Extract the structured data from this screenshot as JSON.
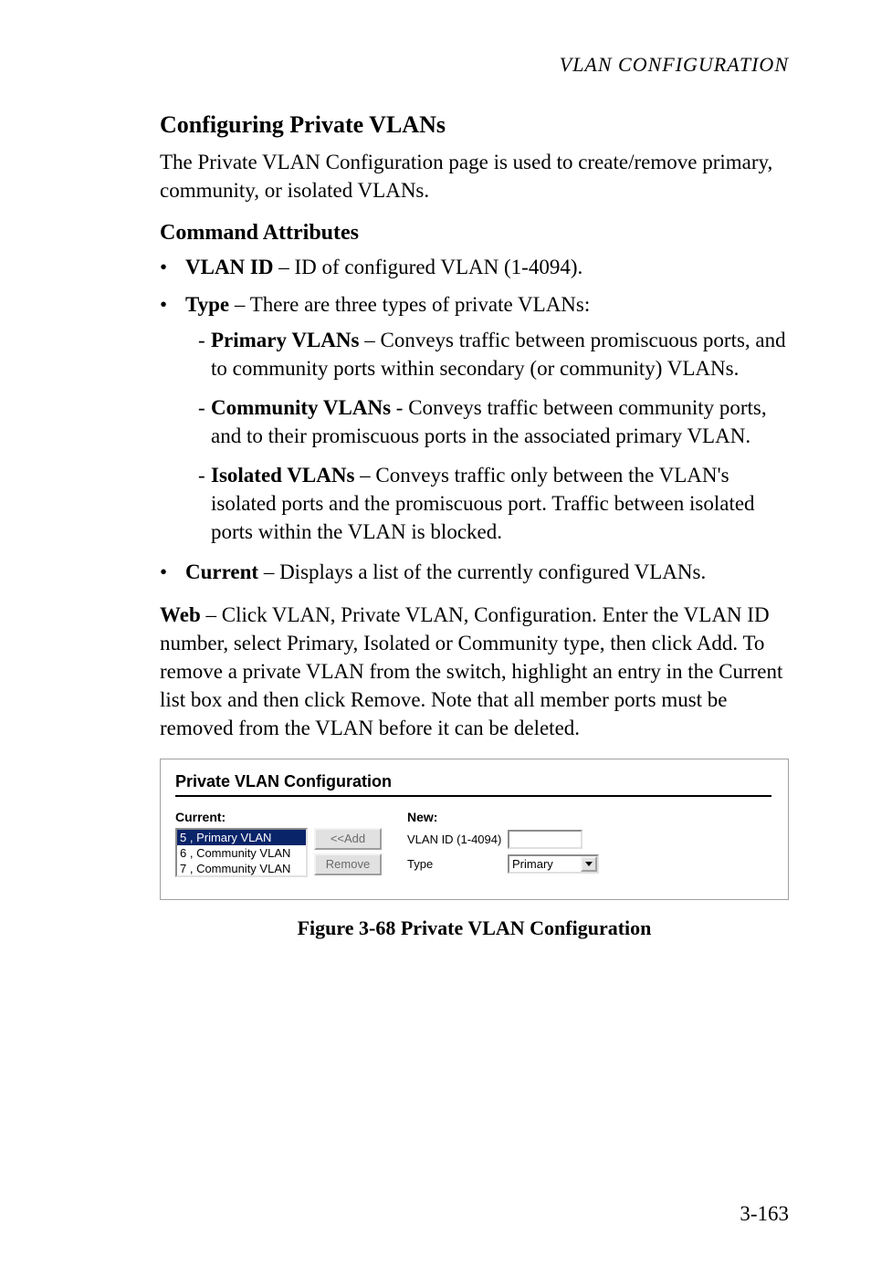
{
  "header": {
    "running_title": "VLAN CONFIGURATION"
  },
  "section": {
    "h2": "Configuring Private VLANs",
    "intro": "The Private VLAN Configuration page is used to create/remove primary, community, or isolated VLANs.",
    "h3": "Command Attributes",
    "bullets": {
      "vlan_id_bold": "VLAN ID",
      "vlan_id_rest": " – ID of configured VLAN (1-4094).",
      "type_bold": "Type",
      "type_rest": " – There are three types of private VLANs:",
      "sub": {
        "primary_bold": "Primary VLANs",
        "primary_rest": " – Conveys traffic between promiscuous ports, and to community ports within secondary (or community) VLANs.",
        "community_bold": "Community VLANs",
        "community_rest": " - Conveys traffic between community ports, and to their  promiscuous ports in the associated primary VLAN.",
        "isolated_bold": "Isolated VLANs",
        "isolated_rest": " – Conveys traffic only between the VLAN's isolated ports and the promiscuous port. Traffic between isolated ports within the VLAN is blocked."
      },
      "current_bold": "Current",
      "current_rest": " – Displays a list of the currently configured VLANs."
    },
    "web_bold": "Web",
    "web_rest": " – Click VLAN, Private VLAN, Configuration. Enter the VLAN ID number, select Primary, Isolated or Community type, then click Add. To remove a private VLAN from the switch, highlight an entry in the Current list box and then click Remove. Note that all member ports must be removed from the VLAN before it can be deleted."
  },
  "figure": {
    "panel_title": "Private VLAN Configuration",
    "labels": {
      "current": "Current:",
      "new": "New:",
      "vlan_id": "VLAN ID (1-4094)",
      "type": "Type"
    },
    "listbox_items": [
      {
        "text": "5 , Primary VLAN",
        "selected": true
      },
      {
        "text": "6 , Community VLAN",
        "selected": false
      },
      {
        "text": "7 , Community VLAN",
        "selected": false
      }
    ],
    "buttons": {
      "add": "<<Add",
      "remove": "Remove"
    },
    "select_value": "Primary",
    "caption": "Figure 3-68  Private VLAN Configuration"
  },
  "page_number": "3-163"
}
